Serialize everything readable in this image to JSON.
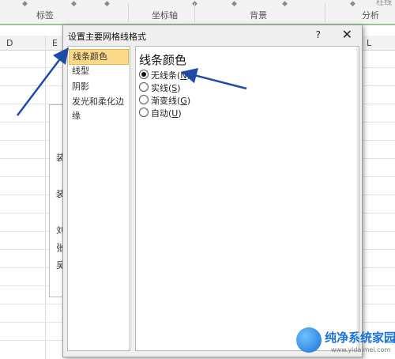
{
  "ribbon": {
    "groups": [
      "标签",
      "坐标轴",
      "背景",
      "分析"
    ],
    "cut_text": "柱线"
  },
  "columns": [
    "D",
    "E",
    "L"
  ],
  "chart_behind": {
    "fragments": [
      "装",
      "装",
      "刘",
      "张",
      "吴"
    ]
  },
  "dialog": {
    "title": "设置主要网格线格式",
    "help_label": "?",
    "close_label": "✕",
    "nav": [
      {
        "label": "线条颜色",
        "selected": true
      },
      {
        "label": "线型",
        "selected": false
      },
      {
        "label": "阴影",
        "selected": false
      },
      {
        "label": "发光和柔化边缘",
        "selected": false
      }
    ],
    "content_heading": "线条颜色",
    "options": [
      {
        "text": "无线条(",
        "key": "N",
        "end": ")",
        "checked": true
      },
      {
        "text": "实线(",
        "key": "S",
        "end": ")",
        "checked": false
      },
      {
        "text": "渐变线(",
        "key": "G",
        "end": ")",
        "checked": false
      },
      {
        "text": "自动(",
        "key": "U",
        "end": ")",
        "checked": false
      }
    ]
  },
  "watermark": {
    "title": "纯净系统家园",
    "url": "www.yidaimei.com"
  },
  "colors": {
    "accent_selected": "#fbd98a",
    "arrow": "#1f4aa8",
    "ribbon_underline": "#9cc39a"
  }
}
